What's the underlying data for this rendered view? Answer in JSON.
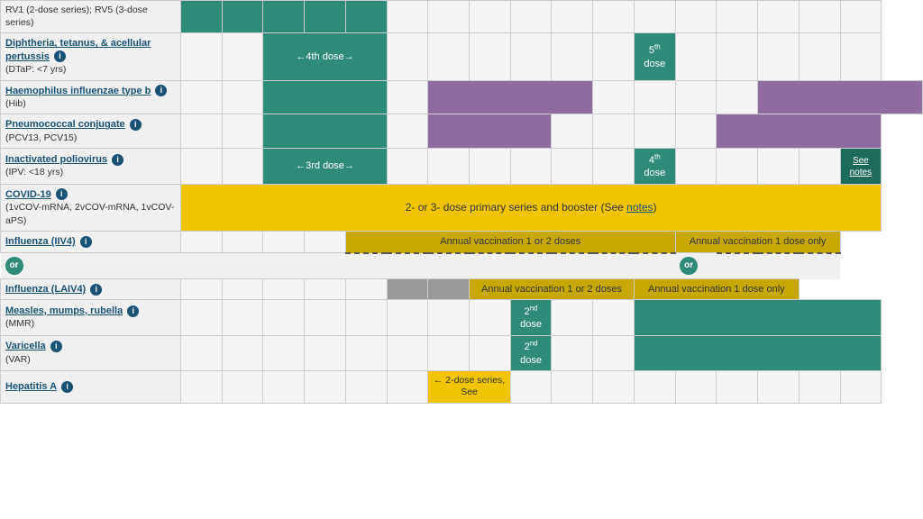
{
  "rows": [
    {
      "id": "rv",
      "name": "",
      "link": "RV1 (2-dose series); RV5 (3-dose series)",
      "hasLink": false,
      "subtitle": "",
      "cells": "rv"
    },
    {
      "id": "dtap",
      "name": "Diphtheria, tetanus, & acellular pertussis",
      "hasLink": true,
      "subtitle": "(DTaP: <7 yrs)",
      "cells": "dtap"
    },
    {
      "id": "hib",
      "name": "Haemophilus influenzae type b",
      "hasLink": true,
      "subtitle": "(Hib)",
      "cells": "hib"
    },
    {
      "id": "pcv",
      "name": "Pneumococcal conjugate",
      "hasLink": true,
      "subtitle": "(PCV13, PCV15)",
      "cells": "pcv"
    },
    {
      "id": "ipv",
      "name": "Inactivated poliovirus",
      "hasLink": true,
      "subtitle": "(IPV: <18 yrs)",
      "cells": "ipv"
    },
    {
      "id": "covid",
      "name": "COVID-19",
      "hasLink": true,
      "subtitle": "(1vCOV-mRNA, 2vCOV-mRNA, 1vCOV-aPS)",
      "cells": "covid"
    },
    {
      "id": "iiiv4",
      "name": "Influenza (IIV4)",
      "hasLink": true,
      "subtitle": "",
      "cells": "iiiv4"
    },
    {
      "id": "laiv4",
      "name": "Influenza (LAIV4)",
      "hasLink": true,
      "subtitle": "",
      "cells": "laiv4"
    },
    {
      "id": "mmr",
      "name": "Measles, mumps, rubella",
      "hasLink": true,
      "subtitle": "(MMR)",
      "cells": "mmr"
    },
    {
      "id": "var",
      "name": "Varicella",
      "hasLink": true,
      "subtitle": "(VAR)",
      "cells": "var"
    },
    {
      "id": "hepa",
      "name": "Hepatitis A",
      "hasLink": true,
      "subtitle": "",
      "cells": "hepa"
    }
  ],
  "labels": {
    "dtap_dose4": "←4th dose→",
    "dtap_dose5": "5th dose",
    "ipv_dose3": "←3rd dose→",
    "ipv_dose4": "4th dose",
    "ipv_seenotes": "See notes",
    "covid_text": "2- or 3- dose primary series and booster (See notes)",
    "influenza_annual1": "Annual vaccination 1 or 2 doses",
    "influenza_annual2": "Annual vaccination 1 dose only",
    "laiv_annual1": "Annual vaccination 1 or 2 doses",
    "laiv_annual2": "Annual vaccination 1 dose only",
    "mmr_dose2": "2nd dose",
    "var_dose2": "2nd dose",
    "hepa_text": "← 2-dose series, See"
  }
}
